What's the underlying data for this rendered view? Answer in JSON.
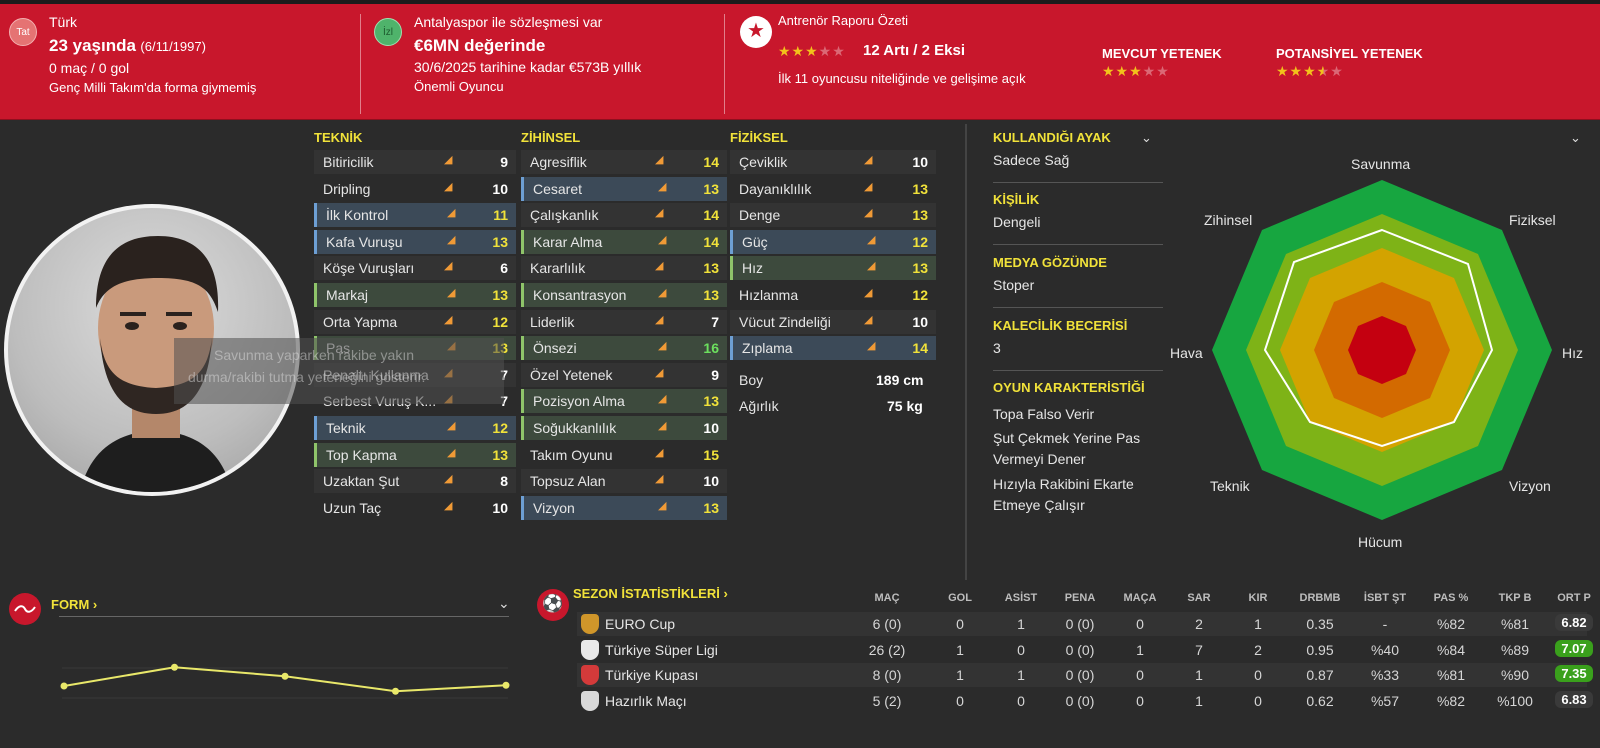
{
  "header": {
    "nationality_badge": "Tat",
    "nationality": "Türk",
    "age": "23 yaşında",
    "dob": "(6/11/1997)",
    "apps": "0 maç / 0 gol",
    "youth_note": "Genç Milli Takım'da forma giymemiş",
    "club_badge": "İzl",
    "contract_title": "Antalyaspor ile sözleşmesi var",
    "value": "€6MN değerinde",
    "contract_until": "30/6/2025 tarihine kadar €573B yıllık",
    "squad_role": "Önemli Oyuncu",
    "report_title": "Antrenör Raporu Özeti",
    "report_pros_cons": "12 Artı / 2 Eksi",
    "report_note": "İlk 11 oyuncusu niteliğinde ve gelişime açık",
    "report_stars": 3,
    "current_ability_label": "MEVCUT YETENEK",
    "current_ability_stars": 3,
    "potential_ability_label": "POTANSİYEL YETENEK",
    "potential_ability_stars": 3.5,
    "accent_color": "#c8172c"
  },
  "tooltip": {
    "line1": "Savunma yaparken rakibe yakın",
    "line2": "durma/rakibi tutma yeteneğini gösterir."
  },
  "attributes": {
    "technical_title": "TEKNİK",
    "mental_title": "ZİHİNSEL",
    "physical_title": "FİZİKSEL",
    "technical": [
      {
        "name": "Bitiricilik",
        "value": "9"
      },
      {
        "name": "Dripling",
        "value": "10"
      },
      {
        "name": "İlk Kontrol",
        "value": "11"
      },
      {
        "name": "Kafa Vuruşu",
        "value": "13"
      },
      {
        "name": "Köşe Vuruşları",
        "value": "6"
      },
      {
        "name": "Markaj",
        "value": "13"
      },
      {
        "name": "Orta Yapma",
        "value": "12"
      },
      {
        "name": "Pas",
        "value": "13"
      },
      {
        "name": "Penaltı Kullanma",
        "value": "7"
      },
      {
        "name": "Serbest Vuruş K...",
        "value": "7"
      },
      {
        "name": "Teknik",
        "value": "12"
      },
      {
        "name": "Top Kapma",
        "value": "13"
      },
      {
        "name": "Uzaktan Şut",
        "value": "8"
      },
      {
        "name": "Uzun Taç",
        "value": "10"
      }
    ],
    "mental": [
      {
        "name": "Agresiflik",
        "value": "14"
      },
      {
        "name": "Cesaret",
        "value": "13"
      },
      {
        "name": "Çalışkanlık",
        "value": "14"
      },
      {
        "name": "Karar Alma",
        "value": "14"
      },
      {
        "name": "Kararlılık",
        "value": "13"
      },
      {
        "name": "Konsantrasyon",
        "value": "13"
      },
      {
        "name": "Liderlik",
        "value": "7"
      },
      {
        "name": "Önsezi",
        "value": "16"
      },
      {
        "name": "Özel Yetenek",
        "value": "9"
      },
      {
        "name": "Pozisyon Alma",
        "value": "13"
      },
      {
        "name": "Soğukkanlılık",
        "value": "10"
      },
      {
        "name": "Takım Oyunu",
        "value": "15"
      },
      {
        "name": "Topsuz Alan",
        "value": "10"
      },
      {
        "name": "Vizyon",
        "value": "13"
      }
    ],
    "physical": [
      {
        "name": "Çeviklik",
        "value": "10"
      },
      {
        "name": "Dayanıklılık",
        "value": "13"
      },
      {
        "name": "Denge",
        "value": "13"
      },
      {
        "name": "Güç",
        "value": "12"
      },
      {
        "name": "Hız",
        "value": "13"
      },
      {
        "name": "Hızlanma",
        "value": "12"
      },
      {
        "name": "Vücut Zindeliği",
        "value": "10"
      },
      {
        "name": "Zıplama",
        "value": "14"
      }
    ],
    "height_label": "Boy",
    "height": "189 cm",
    "weight_label": "Ağırlık",
    "weight": "75 kg"
  },
  "side": {
    "foot_title": "KULLANDIĞI AYAK",
    "foot": "Sadece Sağ",
    "personality_title": "KİŞİLİK",
    "personality": "Dengeli",
    "media_title": "MEDYA GÖZÜNDE",
    "media": "Stoper",
    "gk_title": "KALECİLİK BECERİSİ",
    "gk": "3",
    "traits_title": "OYUN KARAKTERİSTİĞİ",
    "trait1": "Topa Falso Verir",
    "trait2a": "Şut Çekmek Yerine Pas",
    "trait2b": "Vermeyi Dener",
    "trait3a": "Hızıyla Rakibini Ekarte",
    "trait3b": "Etmeye Çalışır"
  },
  "radar": {
    "labels": {
      "top": "Savunma",
      "tr": "Fiziksel",
      "r": "Hız",
      "br": "Vizyon",
      "b": "Hücum",
      "bl": "Teknik",
      "l": "Hava",
      "tl": "Zihinsel"
    }
  },
  "form": {
    "title": "FORM",
    "points": [
      6.82,
      7.07,
      6.95,
      6.75,
      6.83
    ]
  },
  "season": {
    "title": "SEZON İSTATİSTİKLERİ",
    "headers": [
      "MAÇ",
      "GOL",
      "ASİST",
      "PENA",
      "MAÇA",
      "SAR",
      "KIR",
      "DRBMB",
      "İSBT ŞT",
      "PAS %",
      "TKP B",
      "ORT P"
    ],
    "rows": [
      {
        "comp": "EURO Cup",
        "cells": [
          "6 (0)",
          "0",
          "1",
          "0 (0)",
          "0",
          "2",
          "1",
          "0.35",
          "-",
          "%82",
          "%81"
        ],
        "rating": "6.82"
      },
      {
        "comp": "Türkiye Süper Ligi",
        "cells": [
          "26 (2)",
          "1",
          "0",
          "0 (0)",
          "1",
          "7",
          "2",
          "0.95",
          "%40",
          "%84",
          "%89"
        ],
        "rating": "7.07"
      },
      {
        "comp": "Türkiye Kupası",
        "cells": [
          "8 (0)",
          "1",
          "1",
          "0 (0)",
          "0",
          "1",
          "0",
          "0.87",
          "%33",
          "%81",
          "%90"
        ],
        "rating": "7.35"
      },
      {
        "comp": "Hazırlık Maçı",
        "cells": [
          "5 (2)",
          "0",
          "0",
          "0 (0)",
          "0",
          "1",
          "0",
          "0.62",
          "%57",
          "%82",
          "%100"
        ],
        "rating": "6.83"
      }
    ]
  }
}
